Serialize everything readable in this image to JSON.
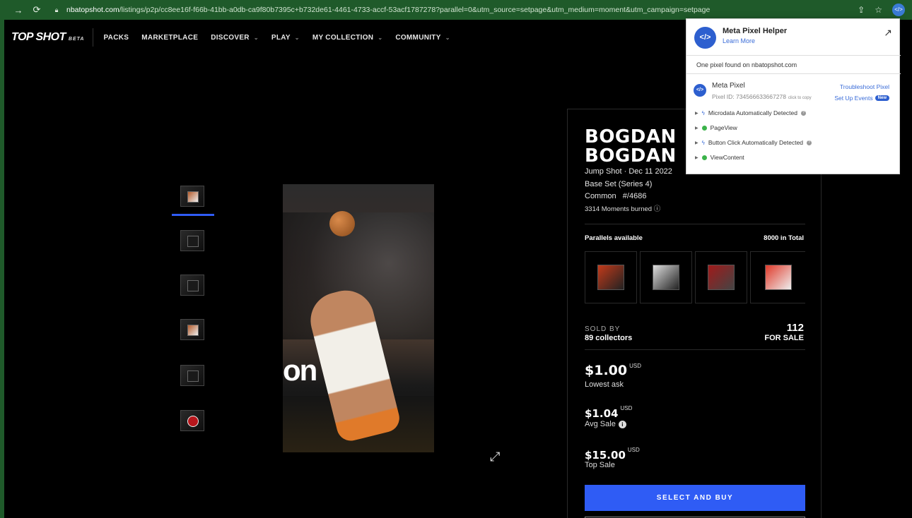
{
  "browser": {
    "url_host": "nbatopshot.com",
    "url_path": "/listings/p2p/cc8ee16f-f66b-41bb-a0db-ca9f80b7395c+b732de61-4461-4733-accf-53acf1787278?parallel=0&utm_source=setpage&utm_medium=moment&utm_campaign=setpage"
  },
  "nav": {
    "logo": "TOP SHOT",
    "beta": "BETA",
    "items": [
      {
        "label": "PACKS",
        "has_chevron": false
      },
      {
        "label": "MARKETPLACE",
        "has_chevron": false
      },
      {
        "label": "DISCOVER",
        "has_chevron": true
      },
      {
        "label": "PLAY",
        "has_chevron": true
      },
      {
        "label": "MY COLLECTION",
        "has_chevron": true
      },
      {
        "label": "COMMUNITY",
        "has_chevron": true
      }
    ]
  },
  "moment": {
    "title_line1": "BOGDAN",
    "title_line2": "BOGDAN",
    "play": "Jump Shot · Dec 11 2022",
    "set": "Base Set (Series 4)",
    "tier": "Common   #/4686",
    "burned": "3314 Moments burned",
    "media_ad_text": "on"
  },
  "parallels": {
    "label": "Parallels available",
    "total": "8000 in Total"
  },
  "sales": {
    "sold_by_label": "SOLD BY",
    "sold_by_value": "89 collectors",
    "for_sale_count": "112",
    "for_sale_label": "FOR SALE",
    "lowest_ask": "$1.00",
    "lowest_ask_label": "Lowest ask",
    "avg_sale": "$1.04",
    "avg_sale_label": "Avg Sale",
    "top_sale": "$15.00",
    "top_sale_label": "Top Sale",
    "currency": "USD",
    "buy_button": "SELECT AND BUY"
  },
  "pixel_helper": {
    "title": "Meta Pixel Helper",
    "learn_more": "Learn More",
    "found_text": "One pixel found on nbatopshot.com",
    "pixel_name": "Meta Pixel",
    "pixel_id": "Pixel ID: 734566633667278",
    "click_to_copy": "click to copy",
    "troubleshoot": "Troubleshoot Pixel",
    "setup_events": "Set Up Events",
    "new_badge": "New",
    "events": [
      {
        "label": "Microdata Automatically Detected",
        "kind": "auto",
        "help": true
      },
      {
        "label": "PageView",
        "kind": "ok",
        "help": false
      },
      {
        "label": "Button Click Automatically Detected",
        "kind": "auto",
        "help": true
      },
      {
        "label": "ViewContent",
        "kind": "ok",
        "help": false
      }
    ]
  },
  "colors": {
    "accent": "#2f5cf5",
    "browser_bar": "#1f5a2a",
    "pixel_blue": "#2d5fcf"
  }
}
